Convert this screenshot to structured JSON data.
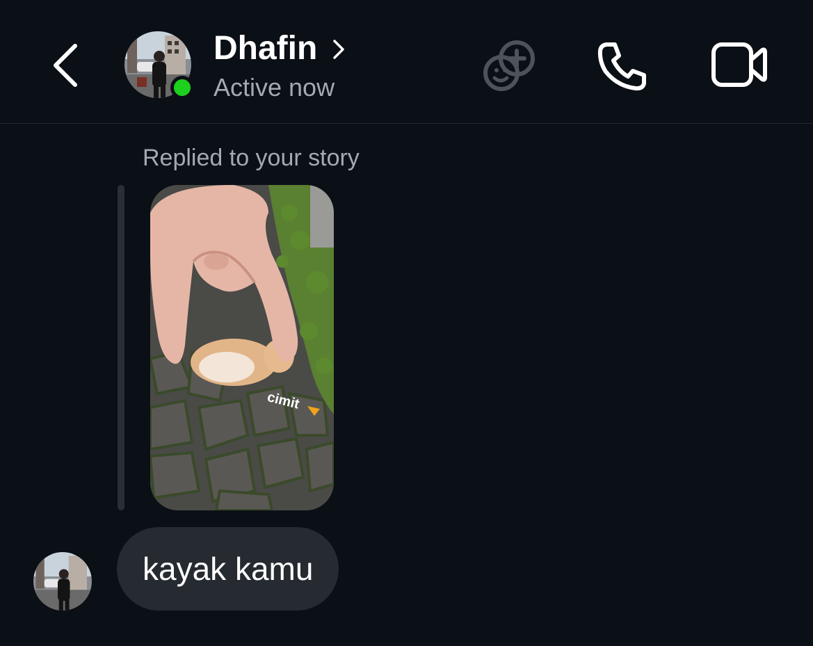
{
  "header": {
    "contact_name": "Dhafin",
    "status": "Active now",
    "icons": {
      "back": "chevron-left-icon",
      "name_chevron": "chevron-right-icon",
      "effects": "sticker-plus-icon",
      "call": "phone-icon",
      "video": "video-camera-icon"
    },
    "online_color": "#1ed01e"
  },
  "thread": {
    "reply_label": "Replied to your story",
    "story": {
      "sticker_text": "cimit"
    },
    "messages": [
      {
        "text": "kayak kamu",
        "from": "Dhafin"
      }
    ]
  },
  "colors": {
    "background": "#0b0f16",
    "bubble": "#262a31",
    "muted_text": "#a4a9b2"
  }
}
